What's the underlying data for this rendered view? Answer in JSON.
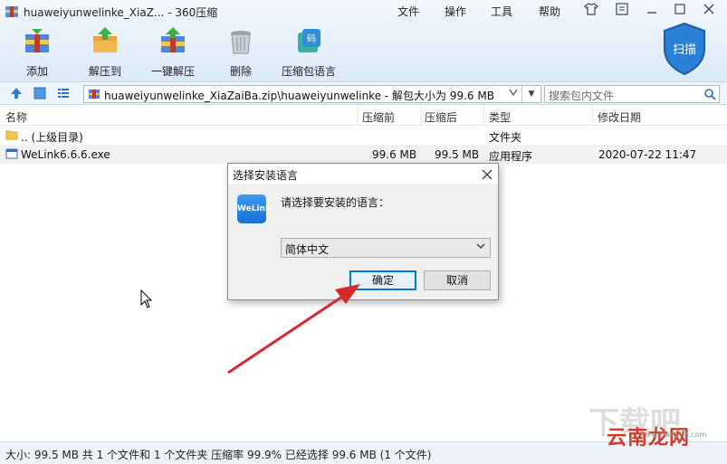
{
  "window": {
    "title": "huaweiyunwelinke_XiaZ... - 360压缩",
    "menus": [
      "文件",
      "操作",
      "工具",
      "帮助"
    ]
  },
  "toolbar": {
    "items": [
      {
        "label": "添加",
        "icon": "add-archive-icon"
      },
      {
        "label": "解压到",
        "icon": "extract-to-icon"
      },
      {
        "label": "一键解压",
        "icon": "one-click-extract-icon"
      },
      {
        "label": "删除",
        "icon": "trash-icon"
      },
      {
        "label": "压缩包语言",
        "icon": "archive-language-icon"
      }
    ],
    "scan_label": "扫描"
  },
  "address": {
    "path": "huaweiyunwelinke_XiaZaiBa.zip\\huaweiyunwelinke - 解包大小为 99.6 MB",
    "search_placeholder": "搜索包内文件"
  },
  "table": {
    "columns": [
      "名称",
      "压缩前",
      "压缩后",
      "类型",
      "修改日期"
    ],
    "rows": [
      {
        "name": ".. (上级目录)",
        "before": "",
        "after": "",
        "type": "文件夹",
        "date": ""
      },
      {
        "name": "WeLink6.6.6.exe",
        "before": "99.6 MB",
        "after": "99.5 MB",
        "type": "应用程序",
        "date": "2020-07-22 11:47"
      }
    ]
  },
  "status": {
    "text": "大小: 99.5 MB 共 1 个文件和 1 个文件夹 压缩率 99.9% 已经选择 99.6 MB (1 个文件)"
  },
  "dialog": {
    "title": "选择安装语言",
    "logo_text": "WeLink",
    "prompt": "请选择要安装的语言：",
    "selected_language": "简体中文",
    "ok_label": "确定",
    "cancel_label": "取消"
  },
  "watermark": {
    "text": "云南龙网",
    "url": "www.xiazaiba.com"
  },
  "colors": {
    "accent": "#0078d7",
    "arrow": "#d42a2a",
    "scan": "#2a7fd6"
  }
}
